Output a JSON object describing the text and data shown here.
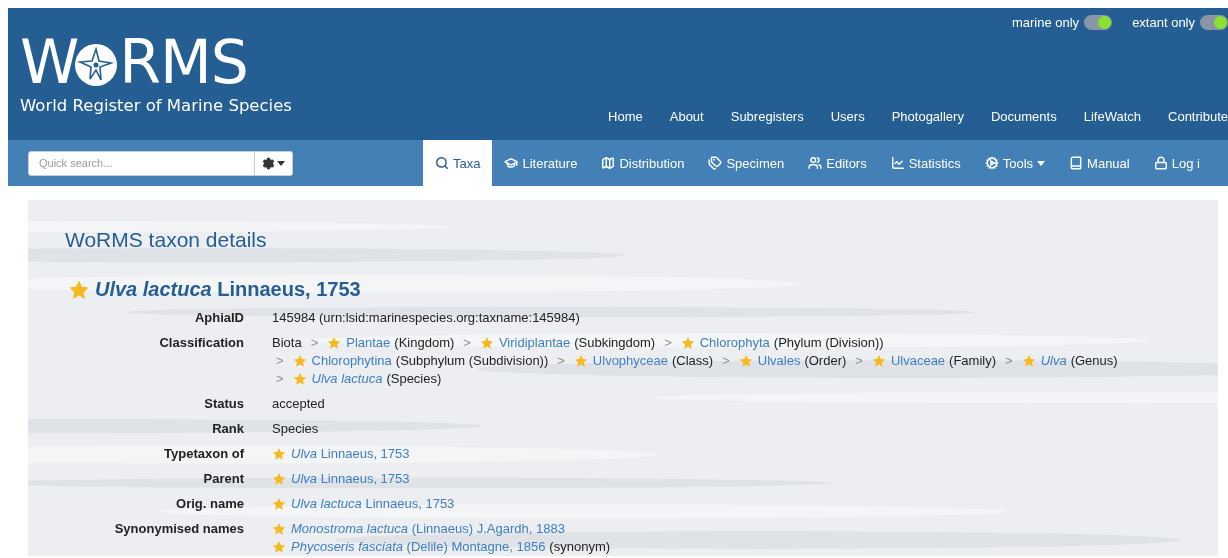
{
  "logo": {
    "before": "W",
    "after": "RMS",
    "tagline": "World Register of Marine Species"
  },
  "toggles": [
    {
      "label": "marine only",
      "on": true
    },
    {
      "label": "extant only",
      "on": true
    }
  ],
  "top_menu": [
    "Home",
    "About",
    "Subregisters",
    "Users",
    "Photogallery",
    "Documents",
    "LifeWatch",
    "Contribute"
  ],
  "search": {
    "placeholder": "Quick search..."
  },
  "tabs": [
    {
      "label": "Taxa",
      "selected": true,
      "dropdown": false
    },
    {
      "label": "Literature",
      "selected": false,
      "dropdown": false
    },
    {
      "label": "Distribution",
      "selected": false,
      "dropdown": false
    },
    {
      "label": "Specimen",
      "selected": false,
      "dropdown": false
    },
    {
      "label": "Editors",
      "selected": false,
      "dropdown": false
    },
    {
      "label": "Statistics",
      "selected": false,
      "dropdown": false
    },
    {
      "label": "Tools",
      "selected": false,
      "dropdown": true
    },
    {
      "label": "Manual",
      "selected": false,
      "dropdown": false
    },
    {
      "label": "Log i",
      "selected": false,
      "dropdown": false
    }
  ],
  "page_title": "WoRMS taxon details",
  "taxon_title": "*Ulva lactuca* Linnaeus, 1753",
  "details": [
    {
      "label": "AphiaID",
      "kind": "text",
      "value": "145984  (urn:lsid:marinespecies.org:taxname:145984)"
    },
    {
      "label": "Classification",
      "kind": "classification",
      "lines": [
        [
          {
            "name": "Biota",
            "link": false
          },
          {
            "sep": ">",
            "name": "Plantae",
            "rank": "(Kingdom)",
            "link": true
          },
          {
            "sep": ">",
            "name": "Viridiplantae",
            "rank": "(Subkingdom)",
            "link": true
          },
          {
            "sep": ">",
            "name": "Chlorophyta",
            "rank": "(Phylum (Division))",
            "link": true
          }
        ],
        [
          {
            "sep": ">",
            "name": "Chlorophytina",
            "rank": "(Subphylum (Subdivision))",
            "link": true
          },
          {
            "sep": ">",
            "name": "Ulvophyceae",
            "rank": "(Class)",
            "link": true
          },
          {
            "sep": ">",
            "name": "Ulvales",
            "rank": "(Order)",
            "link": true
          },
          {
            "sep": ">",
            "name": "Ulvaceae",
            "rank": "(Family)",
            "link": true
          },
          {
            "sep": ">",
            "name": "*Ulva*",
            "rank": "(Genus)",
            "link": true
          }
        ],
        [
          {
            "sep": ">",
            "name": "*Ulva lactuca*",
            "rank": "(Species)",
            "link": true
          }
        ]
      ]
    },
    {
      "label": "Status",
      "kind": "text",
      "value": "accepted"
    },
    {
      "label": "Rank",
      "kind": "text",
      "value": "Species"
    },
    {
      "label": "Typetaxon of",
      "kind": "taxa",
      "items": [
        {
          "name": "*Ulva* Linnaeus, 1753"
        }
      ]
    },
    {
      "label": "Parent",
      "kind": "taxa",
      "items": [
        {
          "name": "*Ulva* Linnaeus, 1753"
        }
      ]
    },
    {
      "label": "Orig. name",
      "kind": "taxa",
      "items": [
        {
          "name": "*Ulva lactuca* Linnaeus, 1753"
        }
      ]
    },
    {
      "label": "Synonymised names",
      "kind": "taxa",
      "items": [
        {
          "name": "*Monostroma lactuca* (Linnaeus) J.Agardh, 1883"
        },
        {
          "name": "*Phycoseris fasciata* (Delile) Montagne, 1856",
          "note": "(synonym)"
        }
      ]
    }
  ]
}
